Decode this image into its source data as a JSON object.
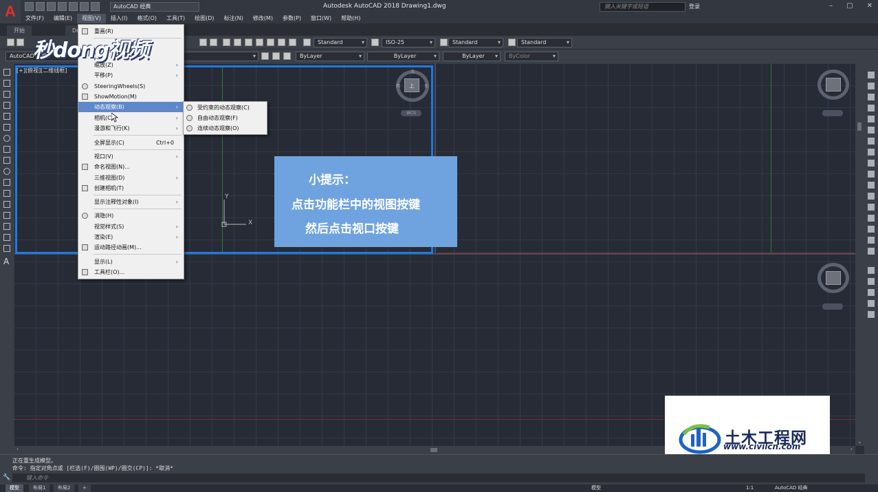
{
  "titlebar": {
    "logo": "A",
    "workspace": "AutoCAD 经典",
    "title": "Autodesk AutoCAD 2018    Drawing1.dwg",
    "search_placeholder": "键入关键字或短语",
    "login": "登录"
  },
  "menubar": [
    "文件(F)",
    "编辑(E)",
    "视图(V)",
    "插入(I)",
    "格式(O)",
    "工具(T)",
    "绘图(D)",
    "标注(N)",
    "修改(M)",
    "参数(P)",
    "窗口(W)",
    "帮助(H)"
  ],
  "doc_tabs": [
    "开始",
    "Dr"
  ],
  "toolbar": {
    "text_style": "Standard",
    "dim_style": "ISO-25",
    "table_style": "Standard",
    "mleader_style": "Standard",
    "layer_workspace": "AutoCAD 经典",
    "color": "ByLayer",
    "linetype": "ByLayer",
    "lineweight": "ByLayer",
    "plotstyle": "ByColor"
  },
  "viewport_label": "[+][俯视][二维线框]",
  "watermark": "秒dong视频",
  "view_menu": {
    "items": [
      {
        "label": "重画(R)",
        "arrow": false
      },
      {
        "label": "缩放(Z)",
        "arrow": true
      },
      {
        "label": "平移(P)",
        "arrow": true
      },
      {
        "label": "SteeringWheels(S)",
        "arrow": false
      },
      {
        "label": "ShowMotion(M)",
        "arrow": false
      },
      {
        "label": "动态观察(B)",
        "arrow": true
      },
      {
        "label": "相机(C)",
        "arrow": true
      },
      {
        "label": "漫游和飞行(K)",
        "arrow": true
      },
      {
        "label": "全屏显示(C)",
        "shortcut": "Ctrl+0"
      },
      {
        "label": "视口(V)",
        "arrow": true
      },
      {
        "label": "命名视图(N)...",
        "arrow": false
      },
      {
        "label": "三维视图(D)",
        "arrow": true
      },
      {
        "label": "创建相机(T)",
        "arrow": false
      },
      {
        "label": "显示注释性对象(I)",
        "arrow": true
      },
      {
        "label": "消隐(H)",
        "arrow": false
      },
      {
        "label": "视觉样式(S)",
        "arrow": true
      },
      {
        "label": "渲染(E)",
        "arrow": true
      },
      {
        "label": "运动路径动画(M)...",
        "arrow": false
      },
      {
        "label": "显示(L)",
        "arrow": true
      },
      {
        "label": "工具栏(O)...",
        "arrow": false
      }
    ]
  },
  "orbit_submenu": [
    "受约束的动态观察(C)",
    "自由动态观察(F)",
    "连续动态观察(O)"
  ],
  "tip": {
    "title": "小提示：",
    "line1": "点击功能栏中的视图按键",
    "line2": "然后点击视口按键"
  },
  "compass": {
    "center": "上",
    "west": "西",
    "east": "东",
    "north": "北",
    "wcs": "WCS"
  },
  "ucs": {
    "x": "X",
    "y": "Y"
  },
  "site_logo": {
    "name": "土木工程网",
    "url": "www.civilcn.com"
  },
  "command": {
    "history1": "正在重生成模型。",
    "history2": "命令: 指定对角点或 [栏选(F)/圈围(WP)/圈交(CP)]: *取消*",
    "input_placeholder": "键入命令"
  },
  "status": {
    "tabs": [
      "模型",
      "布局1",
      "布局2",
      "+"
    ],
    "model": "模型",
    "scale": "1:1",
    "workspace": "AutoCAD 经典"
  },
  "colors": {
    "accent": "#1f7ae0",
    "tip_bg": "#6fa3e0",
    "menu_highlight": "#5e88c9"
  }
}
